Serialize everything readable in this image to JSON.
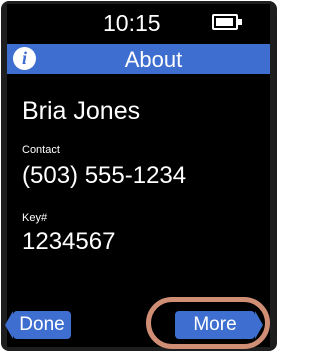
{
  "status": {
    "time": "10:15",
    "battery_icon": "battery-icon"
  },
  "header": {
    "title": "About",
    "info_icon": "info-icon",
    "info_glyph": "i"
  },
  "content": {
    "name": "Bria Jones",
    "contact_label": "Contact",
    "contact_value": "(503) 555-1234",
    "key_label": "Key#",
    "key_value": "1234567"
  },
  "buttons": {
    "done": "Done",
    "more": "More"
  },
  "colors": {
    "accent": "#3e6fd0",
    "highlight": "#d08f75",
    "screen_bg": "#000000"
  }
}
